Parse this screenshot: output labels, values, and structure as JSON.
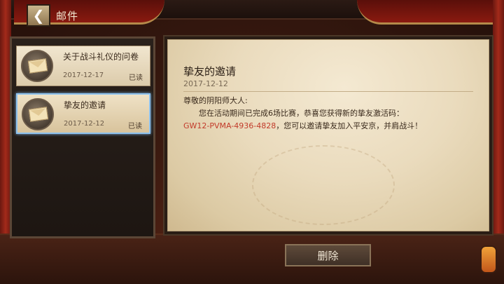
{
  "header": {
    "back_icon": "back-arrow-icon",
    "title": "邮件"
  },
  "mail_list": {
    "items": [
      {
        "subject": "关于战斗礼仪的问卷",
        "date": "2017-12-17",
        "status": "已读"
      },
      {
        "subject": "挚友的邀请",
        "date": "2017-12-12",
        "status": "已读"
      }
    ]
  },
  "letter": {
    "title": "挚友的邀请",
    "date": "2017-12-12",
    "greeting": "尊敬的阴阳师大人:",
    "line1": "您在活动期间已完成6场比赛，恭喜您获得新的挚友激活码：",
    "code": "GW12-PVMA-4936-4828",
    "line2": "，您可以邀请挚友加入平安京，并肩战斗！"
  },
  "actions": {
    "delete_label": "删除"
  }
}
